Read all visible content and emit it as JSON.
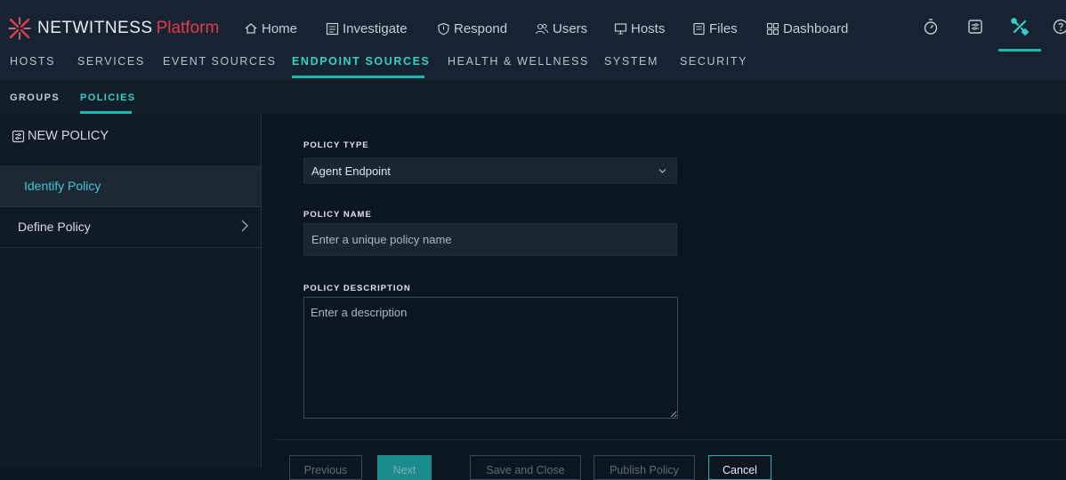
{
  "brand": {
    "name": "NETWITNESS",
    "product": "Platform",
    "accent": "#e33b4e"
  },
  "nav": {
    "items": [
      {
        "label": "Home",
        "icon": "home-icon"
      },
      {
        "label": "Investigate",
        "icon": "investigate-icon"
      },
      {
        "label": "Respond",
        "icon": "shield-icon"
      },
      {
        "label": "Users",
        "icon": "users-icon"
      },
      {
        "label": "Hosts",
        "icon": "hosts-icon"
      },
      {
        "label": "Files",
        "icon": "files-icon"
      },
      {
        "label": "Dashboard",
        "icon": "dashboard-icon"
      }
    ],
    "tools": [
      "timer-icon",
      "notes-icon",
      "admin-tools-icon",
      "help-icon"
    ]
  },
  "admin_tabs": [
    "HOSTS",
    "SERVICES",
    "EVENT SOURCES",
    "ENDPOINT SOURCES",
    "HEALTH & WELLNESS",
    "SYSTEM",
    "SECURITY"
  ],
  "active_admin_tab": "ENDPOINT SOURCES",
  "sub_tabs": [
    "GROUPS",
    "POLICIES"
  ],
  "active_sub_tab": "POLICIES",
  "sidebar": {
    "title": "NEW POLICY",
    "steps": [
      {
        "label": "Identify Policy",
        "active": true
      },
      {
        "label": "Define Policy",
        "active": false
      }
    ]
  },
  "form": {
    "policy_type": {
      "label": "POLICY TYPE",
      "value": "Agent Endpoint"
    },
    "policy_name": {
      "label": "POLICY NAME",
      "placeholder": "Enter a unique policy name"
    },
    "policy_description": {
      "label": "POLICY DESCRIPTION",
      "placeholder": "Enter a description"
    }
  },
  "footer": {
    "previous": "Previous",
    "next": "Next",
    "save_close": "Save and Close",
    "publish": "Publish Policy",
    "cancel": "Cancel"
  },
  "colors": {
    "teal": "#1fb7b0",
    "background": "#0c1622",
    "topbar": "#172330"
  }
}
